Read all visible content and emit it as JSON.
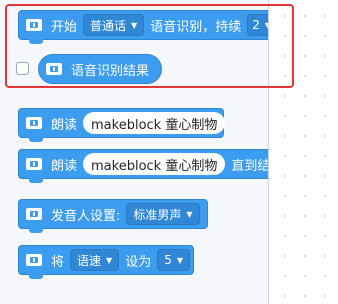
{
  "blocks": {
    "start_recognition": {
      "label_start": "开始",
      "language": "普通话",
      "label_mid": "语音识别，持续",
      "duration": "2"
    },
    "recognition_result": {
      "label": "语音识别结果"
    },
    "speak": {
      "label": "朗读",
      "text": "makeblock 童心制物"
    },
    "speak_until_done": {
      "label": "朗读",
      "text": "makeblock 童心制物",
      "suffix": "直到结束"
    },
    "voice_setting": {
      "label": "发音人设置:",
      "voice": "标准男声"
    },
    "set_param": {
      "label_set": "将",
      "param": "语速",
      "label_to": "设为",
      "value": "5"
    }
  },
  "icons": {
    "block_icon": "microphone-icon",
    "dropdown": "caret-down-icon"
  },
  "colors": {
    "block": "#3c9df0",
    "highlight": "#e53638"
  }
}
